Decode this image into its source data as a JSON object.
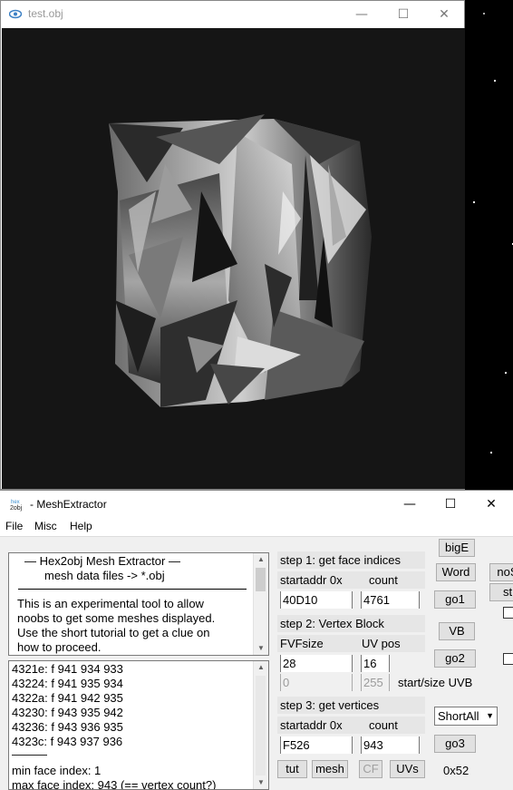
{
  "viewer": {
    "title": "test.obj",
    "controls": {
      "minimize": "—",
      "maximize": "☐",
      "close": "✕"
    }
  },
  "extractor": {
    "title": "- MeshExtractor",
    "icon_text": "hex 2obj",
    "controls": {
      "minimize": "—",
      "maximize": "☐",
      "close": "✕"
    },
    "menu": [
      "File",
      "Misc",
      "Help"
    ],
    "info": {
      "line1": "—   Hex2obj Mesh Extractor   —",
      "line2": "mesh data files -> *.obj",
      "para": [
        "This is an experimental tool to allow",
        "noobs to get some meshes displayed.",
        "Use the short tutorial to get a clue on",
        "how to proceed."
      ]
    },
    "log": {
      "rows": [
        "4321e: f  941 934 933",
        "43224: f  941 935 934",
        "4322a: f  941 942 935",
        "43230: f  943 935 942",
        "43236: f  943 936 935",
        "4323c: f  943 937 936"
      ],
      "sep": "———",
      "min": "min face index: 1",
      "max": "max face index: 943 (== vertex count?)"
    },
    "step1": {
      "title": "step 1: get face indices",
      "start_label": "startaddr 0x",
      "count_label": "count",
      "start": "40D10",
      "count": "4761",
      "go": "go1"
    },
    "step2": {
      "title": "step 2: Vertex Block",
      "fvf_label": "FVFsize",
      "uv_label": "UV pos",
      "fvf": "28",
      "uv": "16",
      "uvb_start": "0",
      "uvb_size": "255",
      "uvb_label": "start/size UVB",
      "go": "go2"
    },
    "step3": {
      "title": "step 3: get vertices",
      "start_label": "startaddr 0x",
      "count_label": "count",
      "start": "F526",
      "count": "943",
      "go": "go3"
    },
    "buttons": {
      "bigE": "bigE",
      "word": "Word",
      "vb": "VB",
      "tut": "tut",
      "mesh": "mesh",
      "cf": "CF",
      "uvs": "UVs",
      "noS": "noS",
      "st": "st"
    },
    "select": "ShortAll",
    "hex": "0x52"
  }
}
